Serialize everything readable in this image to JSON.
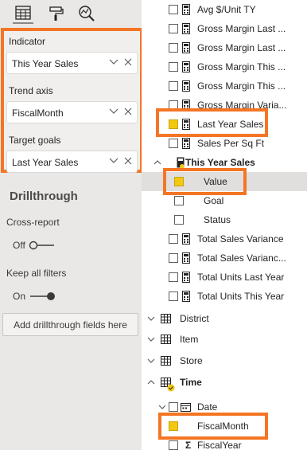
{
  "pane_tabs": [
    {
      "name": "fields-tab",
      "icon": "table-grid-icon"
    },
    {
      "name": "format-tab",
      "icon": "paint-roller-icon"
    },
    {
      "name": "analytics-tab",
      "icon": "magnifier-chart-icon"
    }
  ],
  "wells": {
    "indicator_label": "Indicator",
    "indicator_value": "This Year Sales",
    "trend_label": "Trend axis",
    "trend_value": "FiscalMonth",
    "target_label": "Target goals",
    "target_value": "Last Year Sales"
  },
  "drillthrough": {
    "title": "Drillthrough",
    "cross_report_label": "Cross-report",
    "cross_report_state": "Off",
    "keep_filters_label": "Keep all filters",
    "keep_filters_state": "On",
    "add_fields": "Add drillthrough fields here"
  },
  "fields": [
    {
      "label": "Avg $/Unit TY",
      "type": "measure",
      "checked": false
    },
    {
      "label": "Gross Margin Last ...",
      "type": "measure",
      "checked": false
    },
    {
      "label": "Gross Margin Last ...",
      "type": "measure",
      "checked": false
    },
    {
      "label": "Gross Margin This ...",
      "type": "measure",
      "checked": false
    },
    {
      "label": "Gross Margin This ...",
      "type": "measure",
      "checked": false
    },
    {
      "label": "Gross Margin Varia...",
      "type": "measure",
      "checked": false
    },
    {
      "label": "Last Year Sales",
      "type": "measure",
      "checked": true
    },
    {
      "label": "Sales Per Sq Ft",
      "type": "measure",
      "checked": false
    },
    {
      "label": "This Year Sales",
      "type": "kpi-group",
      "checked": false
    },
    {
      "label": "Value",
      "type": "kpi-child",
      "checked": true
    },
    {
      "label": "Goal",
      "type": "kpi-child",
      "checked": false
    },
    {
      "label": "Status",
      "type": "kpi-child",
      "checked": false
    },
    {
      "label": "Total Sales Variance",
      "type": "measure",
      "checked": false
    },
    {
      "label": "Total Sales Varianc...",
      "type": "measure",
      "checked": false
    },
    {
      "label": "Total Units Last Year",
      "type": "measure",
      "checked": false
    },
    {
      "label": "Total Units This Year",
      "type": "measure",
      "checked": false
    },
    {
      "label": "District",
      "type": "table",
      "checked": false
    },
    {
      "label": "Item",
      "type": "table",
      "checked": false
    },
    {
      "label": "Store",
      "type": "table",
      "checked": false
    },
    {
      "label": "Time",
      "type": "table-expanded",
      "checked": false
    },
    {
      "label": "Date",
      "type": "hierarchy",
      "checked": false
    },
    {
      "label": "FiscalMonth",
      "type": "column",
      "checked": true
    },
    {
      "label": "FiscalYear",
      "type": "sigma",
      "checked": false
    }
  ],
  "colors": {
    "highlight": "#f47524",
    "check_yellow": "#f2c811",
    "pane_left_bg": "#e9e8e7",
    "pane_right_bg": "#ffffff"
  }
}
